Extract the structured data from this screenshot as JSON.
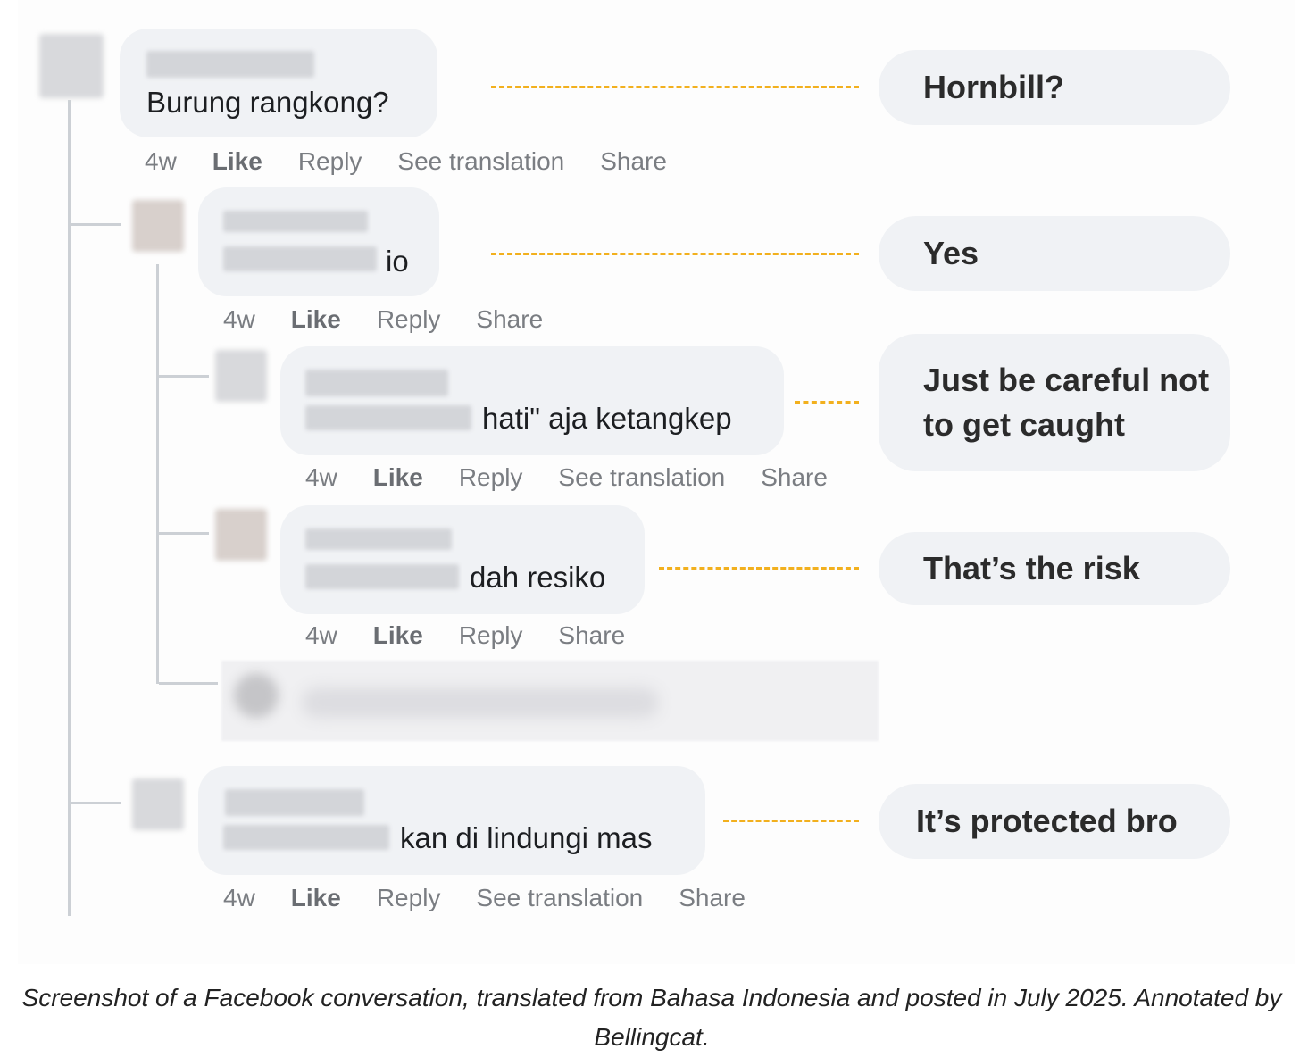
{
  "comments": [
    {
      "text": "Burung rangkong?",
      "actions": [
        "4w",
        "Like",
        "Reply",
        "See translation",
        "Share"
      ],
      "translation": "Hornbill?"
    },
    {
      "text": "io",
      "actions": [
        "4w",
        "Like",
        "Reply",
        "Share"
      ],
      "translation": "Yes"
    },
    {
      "text": "hati\" aja ketangkep",
      "actions": [
        "4w",
        "Like",
        "Reply",
        "See translation",
        "Share"
      ],
      "translation": "Just be careful not to get caught"
    },
    {
      "text": "dah resiko",
      "actions": [
        "4w",
        "Like",
        "Reply",
        "Share"
      ],
      "translation": "That’s the risk"
    },
    {
      "text": "kan di lindungi mas",
      "actions": [
        "4w",
        "Like",
        "Reply",
        "See translation",
        "Share"
      ],
      "translation": "It’s protected bro"
    }
  ],
  "caption": "Screenshot of a Facebook conversation, translated from Bahasa Indonesia and posted in July 2025. Annotated by Bellingcat.",
  "colors": {
    "annotation_dash": "#f2b01e",
    "bubble": "#f0f2f5",
    "thread_line": "#ccd0d5"
  }
}
